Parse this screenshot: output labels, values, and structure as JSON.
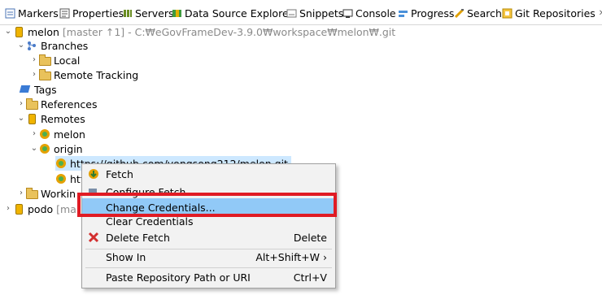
{
  "tabs": [
    {
      "label": "Markers",
      "icon": "markers-icon"
    },
    {
      "label": "Properties",
      "icon": "properties-icon"
    },
    {
      "label": "Servers",
      "icon": "servers-icon"
    },
    {
      "label": "Data Source Explorer",
      "icon": "data-source-icon"
    },
    {
      "label": "Snippets",
      "icon": "snippets-icon"
    },
    {
      "label": "Console",
      "icon": "console-icon"
    },
    {
      "label": "Progress",
      "icon": "progress-icon"
    },
    {
      "label": "Search",
      "icon": "search-icon"
    },
    {
      "label": "Git Repositories",
      "icon": "git-repositories-icon"
    }
  ],
  "tree": {
    "melon": {
      "label": "melon",
      "detail": "[master ↑1] - C:₩eGovFrameDev-3.9.0₩workspace₩melon₩.git"
    },
    "branches": "Branches",
    "local": "Local",
    "remote_tracking": "Remote Tracking",
    "tags": "Tags",
    "references": "References",
    "remotes": "Remotes",
    "remote_melon": "melon",
    "origin": "origin",
    "fetch_url": "https://github.com/yongsong212/melon.git",
    "push_url": "htt",
    "working": "Workin",
    "podo": {
      "label": "podo",
      "detail": "[ma"
    }
  },
  "context_menu": {
    "items": [
      {
        "label": "Fetch",
        "icon": "fetch-icon",
        "shortcut": ""
      },
      {
        "label": "Configure Fetch...",
        "icon": "configure-icon",
        "shortcut": ""
      },
      {
        "label": "Change Credentials...",
        "icon": "",
        "shortcut": ""
      },
      {
        "label": "Clear Credentials",
        "icon": "",
        "shortcut": ""
      },
      {
        "label": "Delete Fetch",
        "icon": "delete-icon",
        "shortcut": "Delete"
      },
      {
        "label": "Show In",
        "icon": "",
        "shortcut": "Alt+Shift+W ›"
      },
      {
        "label": "Paste Repository Path or URI",
        "icon": "",
        "shortcut": "Ctrl+V"
      }
    ]
  },
  "colors": {
    "highlight": "#91c9f7",
    "annotation": "#e01b24",
    "selection": "#cde8ff"
  }
}
